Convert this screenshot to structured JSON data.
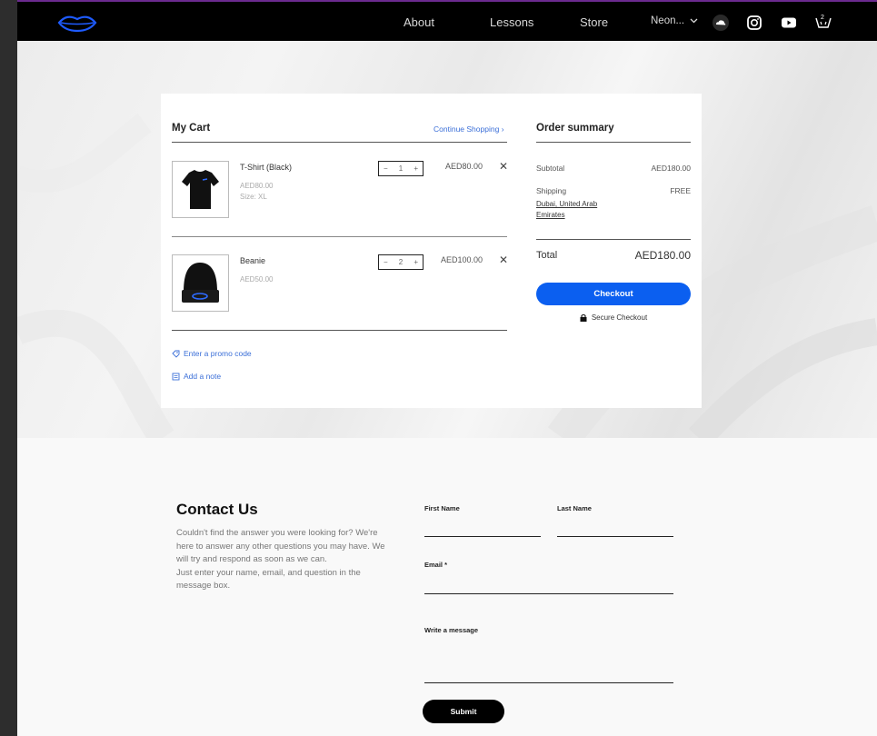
{
  "header": {
    "nav": [
      "About",
      "Lessons",
      "Store"
    ],
    "more_label": "Neon...",
    "social_icons": [
      "soundcloud-icon",
      "instagram-icon",
      "youtube-icon",
      "cart-icon"
    ],
    "cart_count": "2"
  },
  "cart": {
    "title": "My Cart",
    "continue_label": "Continue Shopping",
    "items": [
      {
        "name": "T-Shirt (Black)",
        "unit_price": "AED80.00",
        "option": "Size: XL",
        "quantity": "1",
        "total": "AED80.00"
      },
      {
        "name": "Beanie",
        "unit_price": "AED50.00",
        "option": "",
        "quantity": "2",
        "total": "AED100.00"
      }
    ],
    "promo_label": "Enter a promo code",
    "note_label": "Add a note"
  },
  "summary": {
    "title": "Order summary",
    "subtotal_label": "Subtotal",
    "subtotal_value": "AED180.00",
    "shipping_label": "Shipping",
    "shipping_value": "FREE",
    "shipping_location": "Dubai, United Arab Emirates",
    "total_label": "Total",
    "total_value": "AED180.00",
    "checkout_label": "Checkout",
    "secure_label": "Secure Checkout"
  },
  "contact": {
    "title": "Contact Us",
    "description": "Couldn't find the answer you were looking for? We're here to answer any other questions you may have. We will try and respond as soon as we can.",
    "description2": "Just enter your name, email, and question in the message box.",
    "first_name_label": "First Name",
    "last_name_label": "Last Name",
    "email_label": "Email *",
    "message_label": "Write a message",
    "submit_label": "Submit"
  },
  "colors": {
    "accent": "#0b5ff0",
    "link": "#3b6fd8",
    "header_bg": "#000000",
    "logo": "#1e5bff"
  }
}
